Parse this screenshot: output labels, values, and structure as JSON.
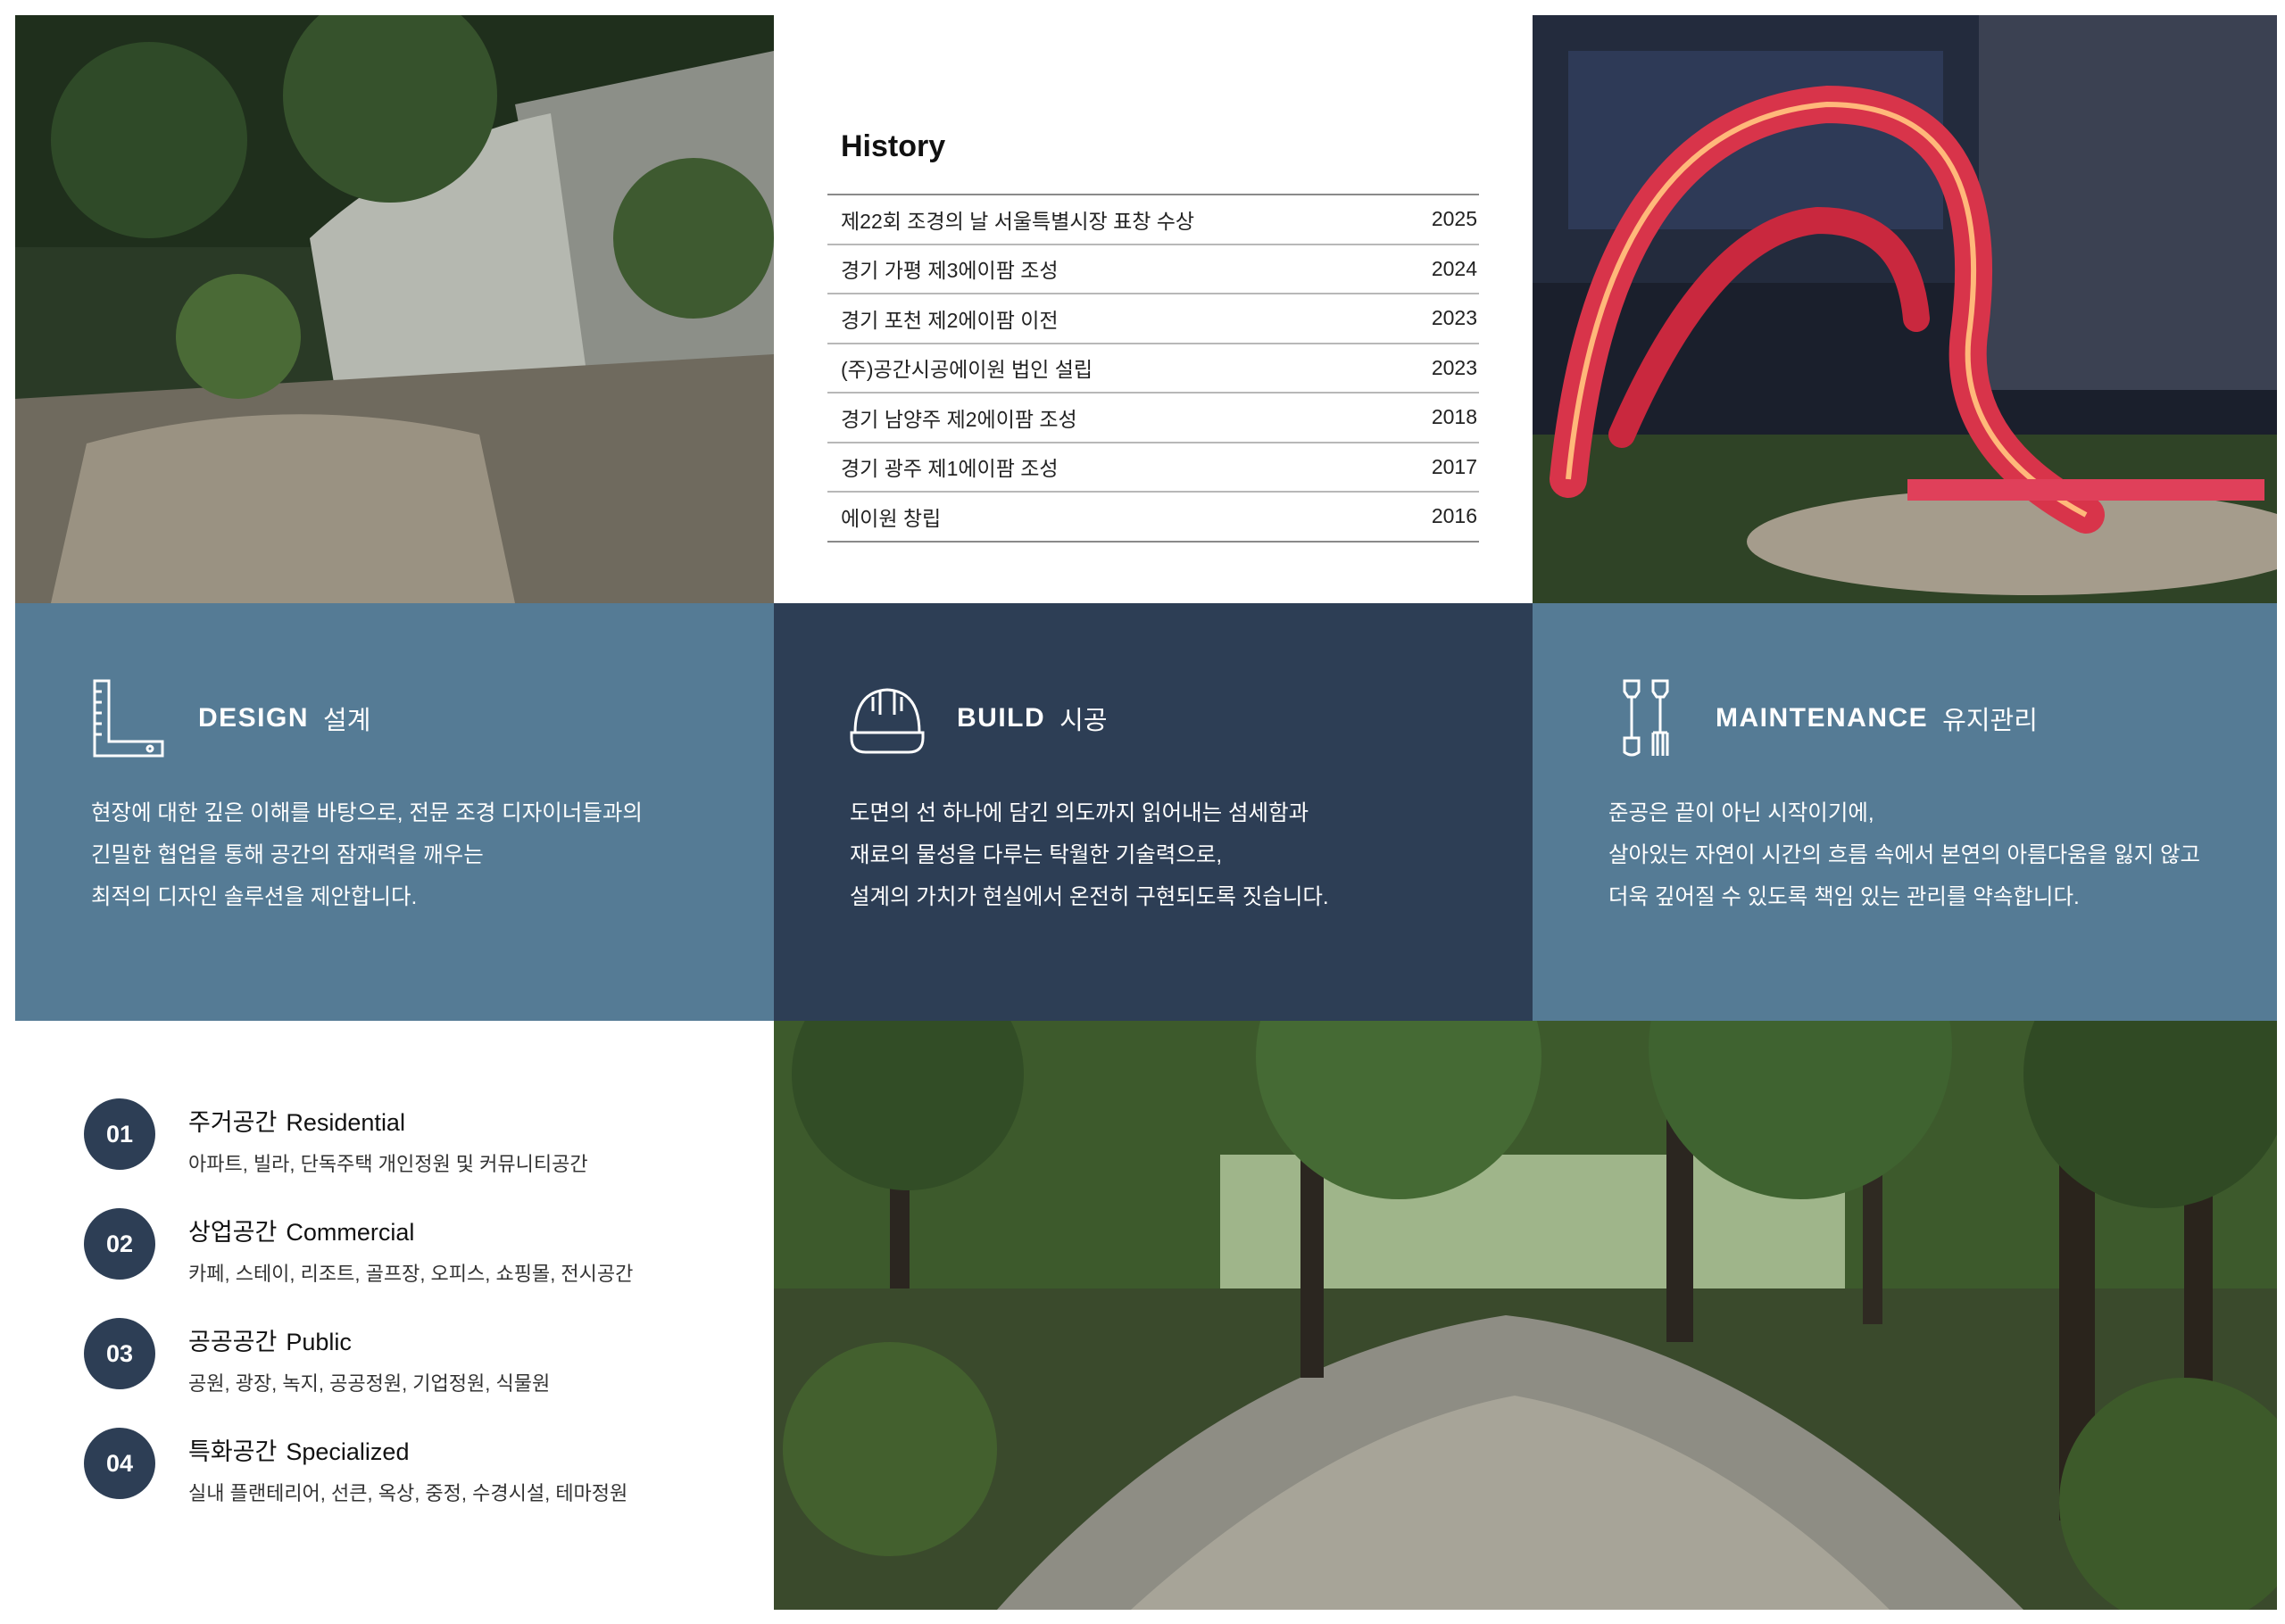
{
  "history": {
    "title": "History",
    "rows": [
      {
        "event": "제22회 조경의 날 서울특별시장 표창 수상",
        "year": "2025"
      },
      {
        "event": "경기 가평 제3에이팜 조성",
        "year": "2024"
      },
      {
        "event": "경기 포천 제2에이팜 이전",
        "year": "2023"
      },
      {
        "event": "(주)공간시공에이원 법인 설립",
        "year": "2023"
      },
      {
        "event": "경기 남양주 제2에이팜 조성",
        "year": "2018"
      },
      {
        "event": "경기 광주 제1에이팜 조성",
        "year": "2017"
      },
      {
        "event": "에이원 창립",
        "year": "2016"
      }
    ]
  },
  "services": {
    "design": {
      "icon": "ruler-square-icon",
      "title": "DESIGN",
      "title_ko": "설계",
      "lines": [
        "현장에 대한 깊은 이해를 바탕으로, 전문 조경 디자이너들과의",
        "긴밀한 협업을 통해 공간의 잠재력을 깨우는",
        "최적의 디자인 솔루션을 제안합니다."
      ],
      "color": "#557b95"
    },
    "build": {
      "icon": "hard-hat-icon",
      "title": "BUILD",
      "title_ko": "시공",
      "lines": [
        "도면의 선 하나에 담긴 의도까지 읽어내는 섬세함과",
        "재료의 물성을 다루는 탁월한 기술력으로,",
        "설계의 가치가 현실에서 온전히 구현되도록 짓습니다."
      ],
      "color": "#2d3e55"
    },
    "maintenance": {
      "icon": "shovel-fork-icon",
      "title": "MAINTENANCE",
      "title_ko": "유지관리",
      "lines": [
        "준공은 끝이 아닌 시작이기에,",
        "살아있는 자연이 시간의 흐름 속에서 본연의 아름다움을 잃지 않고",
        "더욱 깊어질 수 있도록 책임 있는 관리를 약속합니다."
      ],
      "color": "#557b95"
    }
  },
  "categories": [
    {
      "num": "01",
      "title_ko": "주거공간",
      "title_en": "Residential",
      "desc": "아파트, 빌라, 단독주택 개인정원 및 커뮤니티공간"
    },
    {
      "num": "02",
      "title_ko": "상업공간",
      "title_en": "Commercial",
      "desc": "카페, 스테이, 리조트, 골프장, 오피스, 쇼핑몰, 전시공간"
    },
    {
      "num": "03",
      "title_ko": "공공공간",
      "title_en": "Public",
      "desc": "공원, 광장, 녹지, 공공정원, 기업정원, 식물원"
    },
    {
      "num": "04",
      "title_ko": "특화공간",
      "title_en": "Specialized",
      "desc": "실내 플랜테리어, 선큰, 옥상, 중정, 수경시설, 테마정원"
    }
  ]
}
